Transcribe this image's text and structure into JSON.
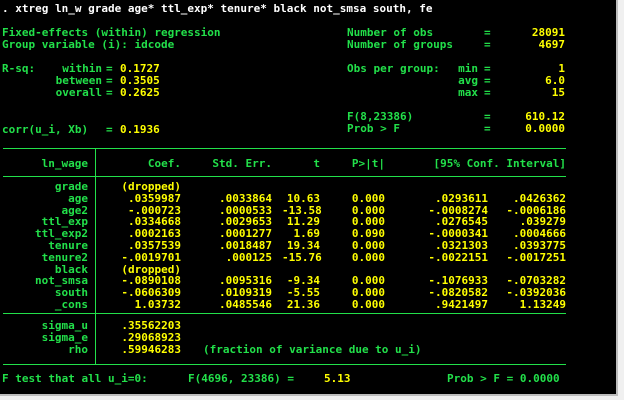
{
  "command": ". xtreg ln_w grade age* ttl_exp* tenure* black not_smsa south, fe",
  "header": {
    "left": [
      {
        "label": "Fixed-effects (within) regression",
        "value": ""
      },
      {
        "label": "Group variable (i): idcode",
        "value": ""
      }
    ],
    "obs_label": "Number of obs",
    "obs_value": "28091",
    "groups_label": "Number of groups",
    "groups_value": "4697",
    "rsq_label": "R-sq:",
    "rsq": [
      {
        "label": "within",
        "value": "0.1727"
      },
      {
        "label": "between",
        "value": "0.3505"
      },
      {
        "label": "overall",
        "value": "0.2625"
      }
    ],
    "obs_per_group_label": "Obs per group:",
    "obs_per_group": [
      {
        "label": "min",
        "value": "1"
      },
      {
        "label": "avg",
        "value": "6.0"
      },
      {
        "label": "max",
        "value": "15"
      }
    ],
    "f_label": "F(8,23386)",
    "f_value": "610.12",
    "prob_label": "Prob > F",
    "prob_value": "0.0000",
    "corr_label": "corr(u_i, Xb)",
    "corr_value": "0.1936"
  },
  "table": {
    "headers": [
      "ln_wage",
      "Coef.",
      "Std. Err.",
      "t",
      "P>|t|",
      "[95% Conf. Interval]"
    ],
    "rows": [
      {
        "var": "grade",
        "coef": "(dropped)",
        "se": "",
        "t": "",
        "p": "",
        "lo": "",
        "hi": ""
      },
      {
        "var": "age",
        "coef": ".0359987",
        "se": ".0033864",
        "t": "10.63",
        "p": "0.000",
        "lo": ".0293611",
        "hi": ".0426362"
      },
      {
        "var": "age2",
        "coef": "-.000723",
        "se": ".0000533",
        "t": "-13.58",
        "p": "0.000",
        "lo": "-.0008274",
        "hi": "-.0006186"
      },
      {
        "var": "ttl_exp",
        "coef": ".0334668",
        "se": ".0029653",
        "t": "11.29",
        "p": "0.000",
        "lo": ".0276545",
        "hi": ".039279"
      },
      {
        "var": "ttl_exp2",
        "coef": ".0002163",
        "se": ".0001277",
        "t": "1.69",
        "p": "0.090",
        "lo": "-.0000341",
        "hi": ".0004666"
      },
      {
        "var": "tenure",
        "coef": ".0357539",
        "se": ".0018487",
        "t": "19.34",
        "p": "0.000",
        "lo": ".0321303",
        "hi": ".0393775"
      },
      {
        "var": "tenure2",
        "coef": "-.0019701",
        "se": ".000125",
        "t": "-15.76",
        "p": "0.000",
        "lo": "-.0022151",
        "hi": "-.0017251"
      },
      {
        "var": "black",
        "coef": "(dropped)",
        "se": "",
        "t": "",
        "p": "",
        "lo": "",
        "hi": ""
      },
      {
        "var": "not_smsa",
        "coef": "-.0890108",
        "se": ".0095316",
        "t": "-9.34",
        "p": "0.000",
        "lo": "-.1076933",
        "hi": "-.0703282"
      },
      {
        "var": "south",
        "coef": "-.0606309",
        "se": ".0109319",
        "t": "-5.55",
        "p": "0.000",
        "lo": "-.0820582",
        "hi": "-.0392036"
      },
      {
        "var": "_cons",
        "coef": "1.03732",
        "se": ".0485546",
        "t": "21.36",
        "p": "0.000",
        "lo": ".9421497",
        "hi": "1.13249"
      }
    ],
    "sigma": [
      {
        "var": "sigma_u",
        "value": ".35562203",
        "note": ""
      },
      {
        "var": "sigma_e",
        "value": ".29068923",
        "note": ""
      },
      {
        "var": "rho",
        "value": ".59946283",
        "note": "(fraction of variance due to u_i)"
      }
    ]
  },
  "footer": {
    "label": "F test that all u_i=0:",
    "stat_label": "F(4696, 23386) =",
    "stat_value": "5.13",
    "prob_label": "Prob > F = 0.0000"
  },
  "colors": {
    "background": "#000000",
    "text": "#22e04a",
    "result": "#ffff00",
    "input": "#ffffff"
  }
}
